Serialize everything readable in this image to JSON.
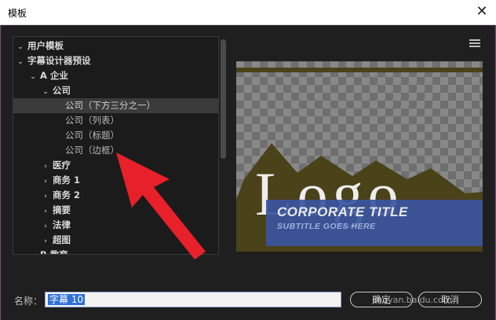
{
  "window": {
    "title": "模板",
    "close_glyph": "✕"
  },
  "tree": {
    "rows": [
      {
        "label": "用户模板",
        "level": 0,
        "expanded": true,
        "bold": true
      },
      {
        "label": "字幕设计器预设",
        "level": 0,
        "expanded": true,
        "bold": true
      },
      {
        "label": "A 企业",
        "level": 1,
        "expanded": true,
        "bold": true
      },
      {
        "label": "公司",
        "level": 2,
        "expanded": true,
        "bold": true
      },
      {
        "label": "公司（下方三分之一）",
        "level": 3,
        "leaf": true,
        "selected": true
      },
      {
        "label": "公司（列表）",
        "level": 3,
        "leaf": true
      },
      {
        "label": "公司（标题）",
        "level": 3,
        "leaf": true
      },
      {
        "label": "公司（边框）",
        "level": 3,
        "leaf": true
      },
      {
        "label": "医疗",
        "level": 2,
        "expanded": false,
        "bold": true
      },
      {
        "label": "商务 1",
        "level": 2,
        "expanded": false,
        "bold": true
      },
      {
        "label": "商务 2",
        "level": 2,
        "expanded": false,
        "bold": true
      },
      {
        "label": "摘要",
        "level": 2,
        "expanded": false,
        "bold": true
      },
      {
        "label": "法律",
        "level": 2,
        "expanded": false,
        "bold": true
      },
      {
        "label": "超图",
        "level": 2,
        "expanded": false,
        "bold": true
      },
      {
        "label": "B 教育",
        "level": 1,
        "expanded": false,
        "bold": true
      }
    ]
  },
  "preview": {
    "logo_text": "Logo",
    "title_text": "CORPORATE TITLE",
    "subtitle_text": "SUBTITLE GOES HERE",
    "colors": {
      "band": "#3a55a0",
      "mountain": "#4a4218",
      "checker": "#6f6f6f"
    }
  },
  "footer": {
    "name_label": "名称：",
    "name_value": "字幕 10",
    "ok_label": "确定",
    "cancel_label": "取消",
    "watermark": "jingyan.baidu.com"
  },
  "annotation": {
    "arrow_color": "#e8202a"
  }
}
